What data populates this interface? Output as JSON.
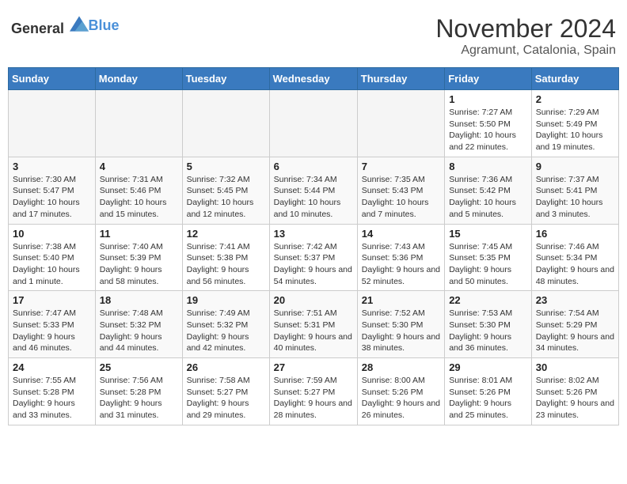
{
  "logo": {
    "text_general": "General",
    "text_blue": "Blue"
  },
  "calendar": {
    "title": "November 2024",
    "subtitle": "Agramunt, Catalonia, Spain",
    "days_of_week": [
      "Sunday",
      "Monday",
      "Tuesday",
      "Wednesday",
      "Thursday",
      "Friday",
      "Saturday"
    ],
    "weeks": [
      [
        {
          "day": "",
          "info": ""
        },
        {
          "day": "",
          "info": ""
        },
        {
          "day": "",
          "info": ""
        },
        {
          "day": "",
          "info": ""
        },
        {
          "day": "",
          "info": ""
        },
        {
          "day": "1",
          "info": "Sunrise: 7:27 AM\nSunset: 5:50 PM\nDaylight: 10 hours and 22 minutes."
        },
        {
          "day": "2",
          "info": "Sunrise: 7:29 AM\nSunset: 5:49 PM\nDaylight: 10 hours and 19 minutes."
        }
      ],
      [
        {
          "day": "3",
          "info": "Sunrise: 7:30 AM\nSunset: 5:47 PM\nDaylight: 10 hours and 17 minutes."
        },
        {
          "day": "4",
          "info": "Sunrise: 7:31 AM\nSunset: 5:46 PM\nDaylight: 10 hours and 15 minutes."
        },
        {
          "day": "5",
          "info": "Sunrise: 7:32 AM\nSunset: 5:45 PM\nDaylight: 10 hours and 12 minutes."
        },
        {
          "day": "6",
          "info": "Sunrise: 7:34 AM\nSunset: 5:44 PM\nDaylight: 10 hours and 10 minutes."
        },
        {
          "day": "7",
          "info": "Sunrise: 7:35 AM\nSunset: 5:43 PM\nDaylight: 10 hours and 7 minutes."
        },
        {
          "day": "8",
          "info": "Sunrise: 7:36 AM\nSunset: 5:42 PM\nDaylight: 10 hours and 5 minutes."
        },
        {
          "day": "9",
          "info": "Sunrise: 7:37 AM\nSunset: 5:41 PM\nDaylight: 10 hours and 3 minutes."
        }
      ],
      [
        {
          "day": "10",
          "info": "Sunrise: 7:38 AM\nSunset: 5:40 PM\nDaylight: 10 hours and 1 minute."
        },
        {
          "day": "11",
          "info": "Sunrise: 7:40 AM\nSunset: 5:39 PM\nDaylight: 9 hours and 58 minutes."
        },
        {
          "day": "12",
          "info": "Sunrise: 7:41 AM\nSunset: 5:38 PM\nDaylight: 9 hours and 56 minutes."
        },
        {
          "day": "13",
          "info": "Sunrise: 7:42 AM\nSunset: 5:37 PM\nDaylight: 9 hours and 54 minutes."
        },
        {
          "day": "14",
          "info": "Sunrise: 7:43 AM\nSunset: 5:36 PM\nDaylight: 9 hours and 52 minutes."
        },
        {
          "day": "15",
          "info": "Sunrise: 7:45 AM\nSunset: 5:35 PM\nDaylight: 9 hours and 50 minutes."
        },
        {
          "day": "16",
          "info": "Sunrise: 7:46 AM\nSunset: 5:34 PM\nDaylight: 9 hours and 48 minutes."
        }
      ],
      [
        {
          "day": "17",
          "info": "Sunrise: 7:47 AM\nSunset: 5:33 PM\nDaylight: 9 hours and 46 minutes."
        },
        {
          "day": "18",
          "info": "Sunrise: 7:48 AM\nSunset: 5:32 PM\nDaylight: 9 hours and 44 minutes."
        },
        {
          "day": "19",
          "info": "Sunrise: 7:49 AM\nSunset: 5:32 PM\nDaylight: 9 hours and 42 minutes."
        },
        {
          "day": "20",
          "info": "Sunrise: 7:51 AM\nSunset: 5:31 PM\nDaylight: 9 hours and 40 minutes."
        },
        {
          "day": "21",
          "info": "Sunrise: 7:52 AM\nSunset: 5:30 PM\nDaylight: 9 hours and 38 minutes."
        },
        {
          "day": "22",
          "info": "Sunrise: 7:53 AM\nSunset: 5:30 PM\nDaylight: 9 hours and 36 minutes."
        },
        {
          "day": "23",
          "info": "Sunrise: 7:54 AM\nSunset: 5:29 PM\nDaylight: 9 hours and 34 minutes."
        }
      ],
      [
        {
          "day": "24",
          "info": "Sunrise: 7:55 AM\nSunset: 5:28 PM\nDaylight: 9 hours and 33 minutes."
        },
        {
          "day": "25",
          "info": "Sunrise: 7:56 AM\nSunset: 5:28 PM\nDaylight: 9 hours and 31 minutes."
        },
        {
          "day": "26",
          "info": "Sunrise: 7:58 AM\nSunset: 5:27 PM\nDaylight: 9 hours and 29 minutes."
        },
        {
          "day": "27",
          "info": "Sunrise: 7:59 AM\nSunset: 5:27 PM\nDaylight: 9 hours and 28 minutes."
        },
        {
          "day": "28",
          "info": "Sunrise: 8:00 AM\nSunset: 5:26 PM\nDaylight: 9 hours and 26 minutes."
        },
        {
          "day": "29",
          "info": "Sunrise: 8:01 AM\nSunset: 5:26 PM\nDaylight: 9 hours and 25 minutes."
        },
        {
          "day": "30",
          "info": "Sunrise: 8:02 AM\nSunset: 5:26 PM\nDaylight: 9 hours and 23 minutes."
        }
      ]
    ]
  }
}
